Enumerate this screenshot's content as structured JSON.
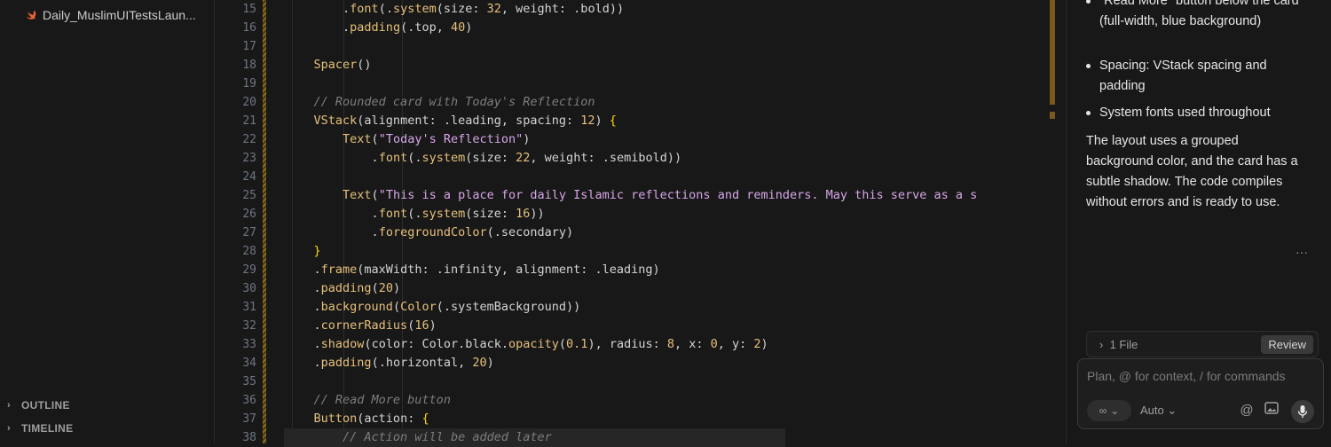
{
  "sidebar": {
    "file_name": "Daily_MuslimUITestsLaun...",
    "sections": [
      "OUTLINE",
      "TIMELINE"
    ]
  },
  "editor": {
    "line_numbers": [
      "15",
      "16",
      "17",
      "18",
      "19",
      "20",
      "21",
      "22",
      "23",
      "24",
      "25",
      "26",
      "27",
      "28",
      "29",
      "30",
      "31",
      "32",
      "33",
      "34",
      "35",
      "36",
      "37",
      "38"
    ],
    "lines": [
      {
        "indent": "        ",
        "tokens": [
          [
            "x",
            "."
          ],
          [
            "fn",
            "font"
          ],
          [
            "x",
            "(."
          ],
          [
            "fn",
            "system"
          ],
          [
            "x",
            "(size: "
          ],
          [
            "n",
            "32"
          ],
          [
            "x",
            ", weight: .bold))"
          ]
        ]
      },
      {
        "indent": "        ",
        "tokens": [
          [
            "x",
            "."
          ],
          [
            "fn",
            "padding"
          ],
          [
            "x",
            "(.top, "
          ],
          [
            "n",
            "40"
          ],
          [
            "x",
            ")"
          ]
        ]
      },
      {
        "indent": "",
        "tokens": []
      },
      {
        "indent": "    ",
        "tokens": [
          [
            "fn",
            "Spacer"
          ],
          [
            "x",
            "()"
          ]
        ]
      },
      {
        "indent": "",
        "tokens": []
      },
      {
        "indent": "    ",
        "tokens": [
          [
            "c",
            "// Rounded card with Today's Reflection"
          ]
        ]
      },
      {
        "indent": "    ",
        "tokens": [
          [
            "fn",
            "VStack"
          ],
          [
            "x",
            "(alignment: .leading, spacing: "
          ],
          [
            "n",
            "12"
          ],
          [
            "x",
            ") "
          ],
          [
            "p",
            "{"
          ]
        ]
      },
      {
        "indent": "        ",
        "tokens": [
          [
            "fn",
            "Text"
          ],
          [
            "x",
            "("
          ],
          [
            "s",
            "\"Today's Reflection\""
          ],
          [
            "x",
            ")"
          ]
        ]
      },
      {
        "indent": "            ",
        "tokens": [
          [
            "x",
            "."
          ],
          [
            "fn",
            "font"
          ],
          [
            "x",
            "(."
          ],
          [
            "fn",
            "system"
          ],
          [
            "x",
            "(size: "
          ],
          [
            "n",
            "22"
          ],
          [
            "x",
            ", weight: .semibold))"
          ]
        ]
      },
      {
        "indent": "",
        "tokens": []
      },
      {
        "indent": "        ",
        "tokens": [
          [
            "fn",
            "Text"
          ],
          [
            "x",
            "("
          ],
          [
            "s",
            "\"This is a place for daily Islamic reflections and reminders. May this serve as a s"
          ]
        ]
      },
      {
        "indent": "            ",
        "tokens": [
          [
            "x",
            "."
          ],
          [
            "fn",
            "font"
          ],
          [
            "x",
            "(."
          ],
          [
            "fn",
            "system"
          ],
          [
            "x",
            "(size: "
          ],
          [
            "n",
            "16"
          ],
          [
            "x",
            "))"
          ]
        ]
      },
      {
        "indent": "            ",
        "tokens": [
          [
            "x",
            "."
          ],
          [
            "fn",
            "foregroundColor"
          ],
          [
            "x",
            "(.secondary)"
          ]
        ]
      },
      {
        "indent": "    ",
        "tokens": [
          [
            "p",
            "}"
          ]
        ]
      },
      {
        "indent": "    ",
        "tokens": [
          [
            "x",
            "."
          ],
          [
            "fn",
            "frame"
          ],
          [
            "x",
            "(maxWidth: .infinity, alignment: .leading)"
          ]
        ]
      },
      {
        "indent": "    ",
        "tokens": [
          [
            "x",
            "."
          ],
          [
            "fn",
            "padding"
          ],
          [
            "x",
            "("
          ],
          [
            "n",
            "20"
          ],
          [
            "x",
            ")"
          ]
        ]
      },
      {
        "indent": "    ",
        "tokens": [
          [
            "x",
            "."
          ],
          [
            "fn",
            "background"
          ],
          [
            "x",
            "("
          ],
          [
            "fn",
            "Color"
          ],
          [
            "x",
            "(.systemBackground))"
          ]
        ]
      },
      {
        "indent": "    ",
        "tokens": [
          [
            "x",
            "."
          ],
          [
            "fn",
            "cornerRadius"
          ],
          [
            "x",
            "("
          ],
          [
            "n",
            "16"
          ],
          [
            "x",
            ")"
          ]
        ]
      },
      {
        "indent": "    ",
        "tokens": [
          [
            "x",
            "."
          ],
          [
            "fn",
            "shadow"
          ],
          [
            "x",
            "(color: Color.black."
          ],
          [
            "fn",
            "opacity"
          ],
          [
            "x",
            "("
          ],
          [
            "n",
            "0.1"
          ],
          [
            "x",
            "), radius: "
          ],
          [
            "n",
            "8"
          ],
          [
            "x",
            ", x: "
          ],
          [
            "n",
            "0"
          ],
          [
            "x",
            ", y: "
          ],
          [
            "n",
            "2"
          ],
          [
            "x",
            ")"
          ]
        ]
      },
      {
        "indent": "    ",
        "tokens": [
          [
            "x",
            "."
          ],
          [
            "fn",
            "padding"
          ],
          [
            "x",
            "(.horizontal, "
          ],
          [
            "n",
            "20"
          ],
          [
            "x",
            ")"
          ]
        ]
      },
      {
        "indent": "",
        "tokens": []
      },
      {
        "indent": "    ",
        "tokens": [
          [
            "c",
            "// Read More button"
          ]
        ]
      },
      {
        "indent": "    ",
        "tokens": [
          [
            "fn",
            "Button"
          ],
          [
            "x",
            "(action: "
          ],
          [
            "p",
            "{"
          ]
        ]
      },
      {
        "indent": "        ",
        "tokens": [
          [
            "c",
            "// Action will be added later"
          ]
        ]
      }
    ]
  },
  "chat": {
    "bullets": [
      "\"Read More\" button below the card (full-width, blue background)",
      "Spacing: VStack spacing and padding",
      "System fonts used throughout"
    ],
    "paragraph": "The layout uses a grouped background color, and the card has a subtle shadow. The code compiles without errors and is ready to use.",
    "more_label": "···",
    "files_label": "1 File",
    "review_label": "Review",
    "input_placeholder": "Plan, @ for context, / for commands",
    "mode_label": "∞",
    "model_label": "Auto",
    "icons": [
      "at-icon",
      "image-icon",
      "mic-icon"
    ]
  },
  "colors": {
    "background": "#181818",
    "keyword": "#e5c07b",
    "string": "#d7a6e8",
    "comment": "#7d7d7d",
    "modified_gutter": "#8a6a1f"
  }
}
